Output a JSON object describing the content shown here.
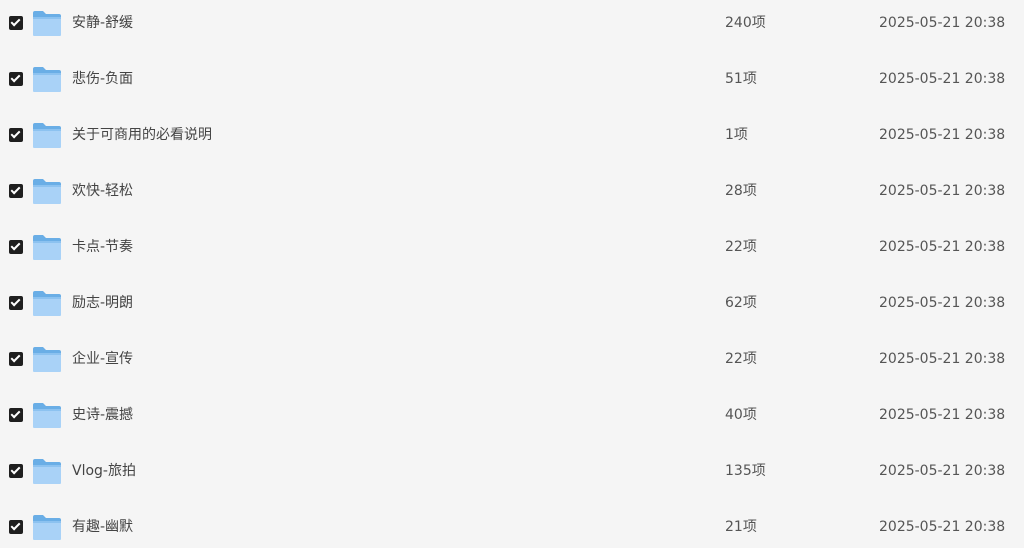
{
  "file_list": {
    "items": [
      {
        "name": "安静-舒缓",
        "count": "240项",
        "modified": "2025-05-21 20:38",
        "checked": true
      },
      {
        "name": "悲伤-负面",
        "count": "51项",
        "modified": "2025-05-21 20:38",
        "checked": true
      },
      {
        "name": "关于可商用的必看说明",
        "count": "1项",
        "modified": "2025-05-21 20:38",
        "checked": true
      },
      {
        "name": "欢快-轻松",
        "count": "28项",
        "modified": "2025-05-21 20:38",
        "checked": true
      },
      {
        "name": "卡点-节奏",
        "count": "22项",
        "modified": "2025-05-21 20:38",
        "checked": true
      },
      {
        "name": "励志-明朗",
        "count": "62项",
        "modified": "2025-05-21 20:38",
        "checked": true
      },
      {
        "name": "企业-宣传",
        "count": "22项",
        "modified": "2025-05-21 20:38",
        "checked": true
      },
      {
        "name": "史诗-震撼",
        "count": "40项",
        "modified": "2025-05-21 20:38",
        "checked": true
      },
      {
        "name": "Vlog-旅拍",
        "count": "135项",
        "modified": "2025-05-21 20:38",
        "checked": true
      },
      {
        "name": "有趣-幽默",
        "count": "21项",
        "modified": "2025-05-21 20:38",
        "checked": true
      }
    ],
    "folder_icon": "folder-icon",
    "checkbox_icon": "checkbox-checked-icon"
  },
  "colors": {
    "background": "#f5f5f5",
    "checkbox": "#1f1f1f",
    "folder_light": "#a9d2f7",
    "folder_dark": "#6aaee6"
  }
}
